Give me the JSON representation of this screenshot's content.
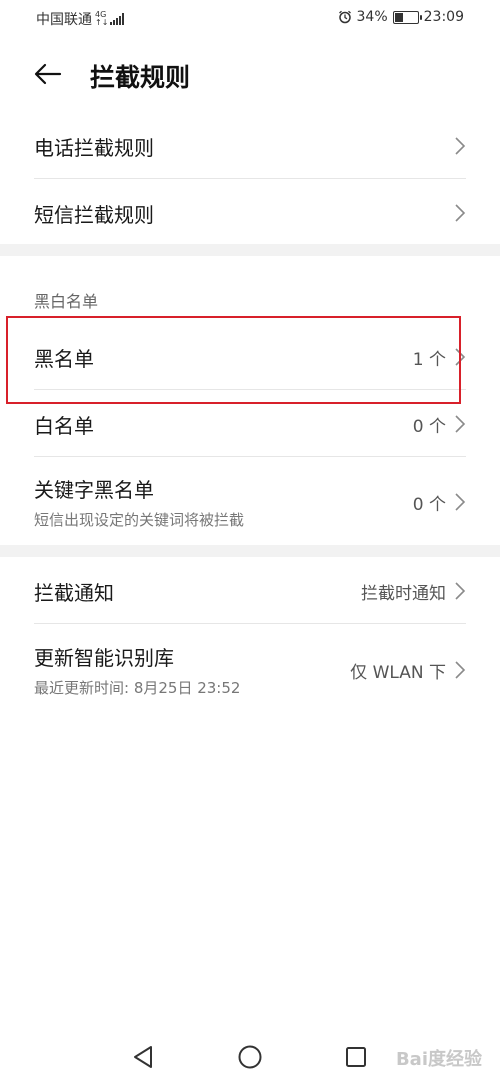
{
  "status_bar": {
    "carrier": "中国联通",
    "network_top": "4G",
    "network_bottom": "↑↓",
    "battery": "34%",
    "battery_level": 0.34,
    "time": "23:09"
  },
  "header": {
    "title": "拦截规则"
  },
  "rules": [
    {
      "label": "电话拦截规则"
    },
    {
      "label": "短信拦截规则"
    }
  ],
  "lists_section": {
    "header": "黑白名单",
    "items": [
      {
        "label": "黑名单",
        "value": "1 个"
      },
      {
        "label": "白名单",
        "value": "0 个"
      },
      {
        "label": "关键字黑名单",
        "sub": "短信出现设定的关键词将被拦截",
        "value": "0 个"
      }
    ]
  },
  "other": [
    {
      "label": "拦截通知",
      "value": "拦截时通知"
    },
    {
      "label": "更新智能识别库",
      "sub": "最近更新时间: 8月25日 23:52",
      "value": "仅 WLAN 下"
    }
  ],
  "watermark": "Bai度经验",
  "colors": {
    "highlight": "#d8202a",
    "band": "#f2f2f2"
  }
}
